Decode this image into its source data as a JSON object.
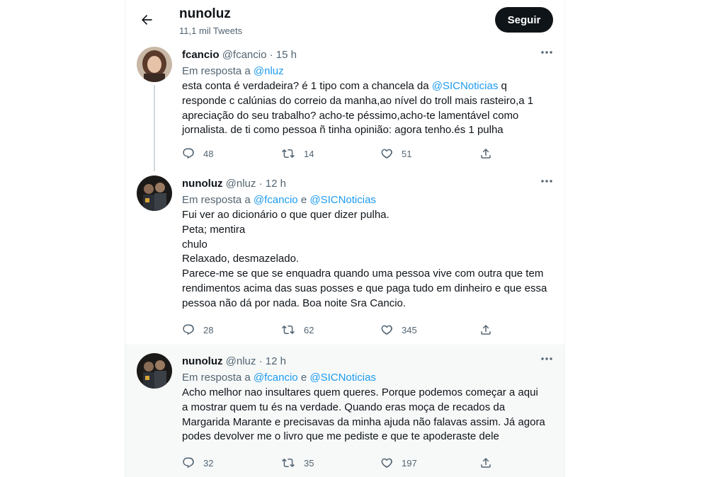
{
  "header": {
    "title": "nunoluz",
    "subtitle": "11,1 mil Tweets",
    "follow_label": "Seguir"
  },
  "tweets": [
    {
      "name": "fcancio",
      "handle": "@fcancio",
      "separator": "·",
      "time": "15 h",
      "reply_prefix": "Em resposta a",
      "reply_mention_1": "@nluz",
      "reply_joiner": "",
      "reply_mention_2": "",
      "body_lines": [
        {
          "text_before": "esta conta é verdadeira? é 1 tipo com a chancela da ",
          "mention": "@SICNoticias",
          "text_after": " q"
        },
        {
          "text_before": "responde c calúnias do correio da manha,ao nível do troll mais rasteiro,a 1",
          "mention": "",
          "text_after": ""
        },
        {
          "text_before": "apreciação do seu trabalho? acho-te péssimo,acho-te lamentável como",
          "mention": "",
          "text_after": ""
        },
        {
          "text_before": "jornalista. de ti como pessoa ñ tinha opinião: agora tenho.és 1 pulha",
          "mention": "",
          "text_after": ""
        }
      ],
      "replies": "48",
      "retweets": "14",
      "likes": "51",
      "avatar_icon": "woman-portrait-avatar"
    },
    {
      "name": "nunoluz",
      "handle": "@nluz",
      "separator": "·",
      "time": "12 h",
      "reply_prefix": "Em resposta a",
      "reply_mention_1": "@fcancio",
      "reply_joiner": "e",
      "reply_mention_2": "@SICNoticias",
      "body_lines": [
        {
          "text_before": "Fui ver ao dicionário o que quer dizer pulha.",
          "mention": "",
          "text_after": ""
        },
        {
          "text_before": "Peta; mentira",
          "mention": "",
          "text_after": ""
        },
        {
          "text_before": "chulo",
          "mention": "",
          "text_after": ""
        },
        {
          "text_before": "Relaxado, desmazelado.",
          "mention": "",
          "text_after": ""
        },
        {
          "text_before": "Parece-me se que se enquadra quando uma pessoa vive com outra que tem",
          "mention": "",
          "text_after": ""
        },
        {
          "text_before": "rendimentos acima das suas posses e que paga tudo em dinheiro e que essa",
          "mention": "",
          "text_after": ""
        },
        {
          "text_before": "pessoa não dá por nada. Boa noite Sra Cancio.",
          "mention": "",
          "text_after": ""
        }
      ],
      "replies": "28",
      "retweets": "62",
      "likes": "345",
      "avatar_icon": "two-men-portrait-avatar"
    },
    {
      "name": "nunoluz",
      "handle": "@nluz",
      "separator": "·",
      "time": "12 h",
      "reply_prefix": "Em resposta a",
      "reply_mention_1": "@fcancio",
      "reply_joiner": "e",
      "reply_mention_2": "@SICNoticias",
      "body_lines": [
        {
          "text_before": "Acho melhor nao insultares quem queres. Porque podemos começar a aqui",
          "mention": "",
          "text_after": ""
        },
        {
          "text_before": "a mostrar quem tu és na verdade. Quando eras moça de recados da",
          "mention": "",
          "text_after": ""
        },
        {
          "text_before": "Margarida Marante e precisavas da minha ajuda não falavas assim. Já agora",
          "mention": "",
          "text_after": ""
        },
        {
          "text_before": "podes devolver me o livro que me pediste e que te apoderaste dele",
          "mention": "",
          "text_after": ""
        }
      ],
      "replies": "32",
      "retweets": "35",
      "likes": "197",
      "avatar_icon": "two-men-portrait-avatar"
    }
  ],
  "colors": {
    "text": "#0f1419",
    "muted": "#536471",
    "link": "#1d9bf0",
    "follow_bg": "#0f1419",
    "thread_line": "#cfd9de",
    "highlight_bg": "#f7f9f9"
  }
}
